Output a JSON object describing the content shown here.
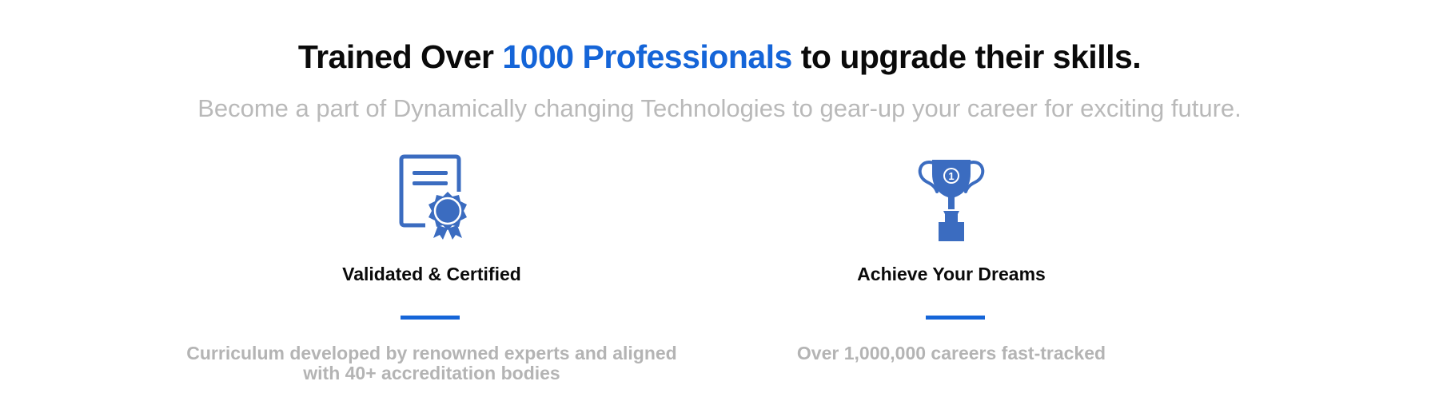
{
  "headline": {
    "prefix": "Trained Over ",
    "highlight": "1000 Professionals",
    "suffix": " to upgrade their skills."
  },
  "subhead": "Become a part of Dynamically changing Technologies to gear-up your career for exciting future.",
  "features": [
    {
      "icon": "certificate-icon",
      "title": "Validated & Certified",
      "description": "Curriculum developed by renowned experts and aligned with 40+ accreditation bodies"
    },
    {
      "icon": "trophy-icon",
      "title": "Achieve Your Dreams",
      "description": "Over 1,000,000 careers fast-tracked"
    }
  ],
  "colors": {
    "accent": "#1565d8",
    "icon": "#3b6cc0",
    "heading": "#0a0a0a",
    "muted": "#b9b9b9"
  }
}
